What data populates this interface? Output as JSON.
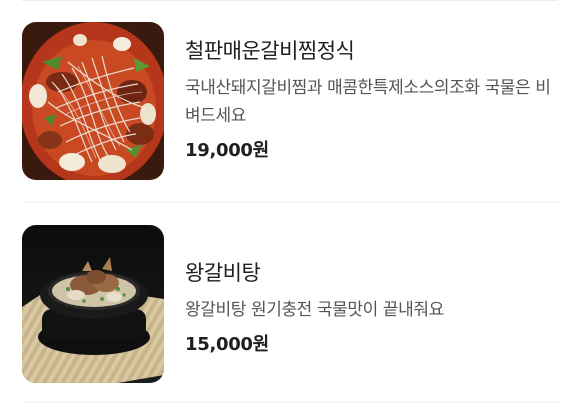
{
  "menu": {
    "items": [
      {
        "name": "철판매운갈비찜정식",
        "description": "국내산돼지갈비찜과 매콤한특제소스의조화 국물은 비벼드세요",
        "price": "19,000원",
        "image_icon": "spicy-braised-ribs-photo"
      },
      {
        "name": "왕갈비탕",
        "description": "왕갈비탕 원기충전 국물맛이 끝내줘요",
        "price": "15,000원",
        "image_icon": "galbitang-photo"
      }
    ]
  }
}
